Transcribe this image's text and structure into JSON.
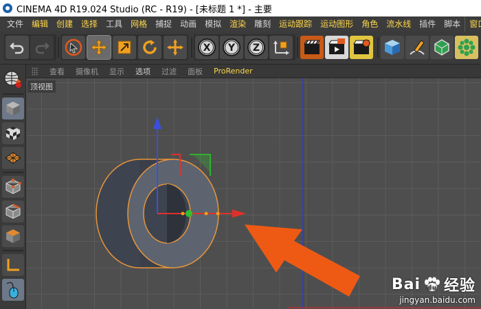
{
  "titlebar": {
    "title": "CINEMA 4D R19.024 Studio (RC - R19) - [未标题 1 *] - 主要"
  },
  "menubar": {
    "items": [
      "文件",
      "编辑",
      "创建",
      "选择",
      "工具",
      "网格",
      "捕捉",
      "动画",
      "模拟",
      "渲染",
      "雕刻",
      "运动跟踪",
      "运动图形",
      "角色",
      "流水线",
      "插件",
      "脚本",
      "窗口"
    ]
  },
  "toolbar": {
    "tools": [
      "undo-icon",
      "redo-icon",
      "live-select-icon",
      "move-icon",
      "scale-icon",
      "rotate-icon",
      "transform-icon",
      "x-axis-lock-icon",
      "y-axis-lock-icon",
      "z-axis-lock-icon",
      "coordinate-system-icon",
      "render-view-icon",
      "render-to-picture-viewer-icon",
      "render-settings-icon",
      "cube-icon",
      "pen-icon",
      "subdivision-icon",
      "cloner-icon"
    ]
  },
  "viewport_menu": {
    "items": [
      "查看",
      "摄像机",
      "显示",
      "选项",
      "过滤",
      "面板",
      "ProRender"
    ]
  },
  "viewport": {
    "label": "顶视图"
  },
  "watermark": {
    "brand": "Bai",
    "brand_suffix": "经验",
    "url": "jingyan.baidu.com"
  },
  "colors": {
    "accent_yellow": "#ffd84a",
    "viewport_bg": "#4e4e4e",
    "object_fill": "#5d6470",
    "selection_outline": "#e8963a",
    "axis_x": "#e0302a",
    "axis_y": "#3a4fe0",
    "annotation_arrow": "#ee5a14"
  }
}
